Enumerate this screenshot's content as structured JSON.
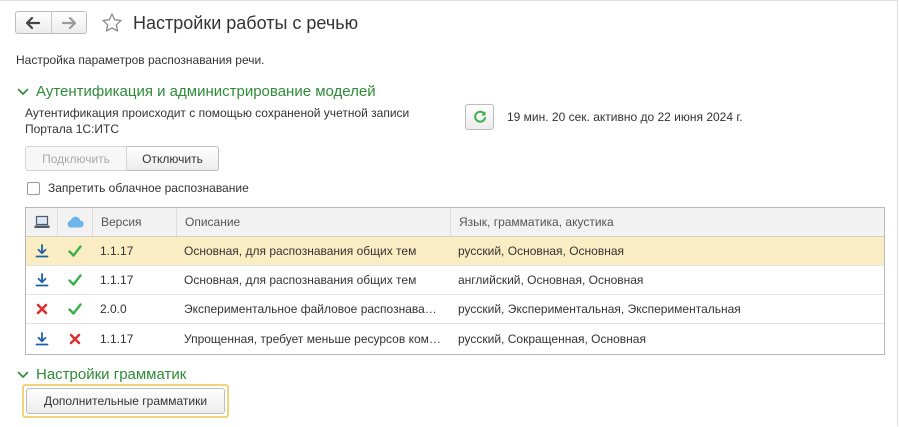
{
  "header": {
    "title": "Настройки работы с речью",
    "back_icon": "arrow-left-icon",
    "forward_icon": "arrow-right-icon",
    "favorite_icon": "star-icon"
  },
  "subtitle": "Настройка параметров распознавания речи.",
  "auth_section": {
    "title": "Аутентификация и администрирование моделей",
    "auth_text": "Аутентификация происходит с помощью сохраненой учетной записи Портала 1С:ИТС",
    "status_text": "19 мин. 20 сек. активно до 22 июня 2024 г.",
    "connect_label": "Подключить",
    "disconnect_label": "Отключить",
    "disable_cloud_label": "Запретить облачное распознавание",
    "disable_cloud_checked": false
  },
  "table": {
    "columns": {
      "local_icon": "computer-icon",
      "cloud_icon": "cloud-icon",
      "version": "Версия",
      "description": "Описание",
      "language": "Язык, грамматика, акустика"
    },
    "rows": [
      {
        "local": "download",
        "cloud": "check",
        "version": "1.1.17",
        "description": "Основная, для распознавания общих тем",
        "language": "русский, Основная, Основная",
        "selected": true
      },
      {
        "local": "download",
        "cloud": "check",
        "version": "1.1.17",
        "description": "Основная, для распознавания общих тем",
        "language": "английский, Основная, Основная",
        "selected": false
      },
      {
        "local": "cross",
        "cloud": "check",
        "version": "2.0.0",
        "description": "Экспериментальное файловое распознавание",
        "language": "русский, Экспериментальная, Экспериментальная",
        "selected": false
      },
      {
        "local": "download",
        "cloud": "cross",
        "version": "1.1.17",
        "description": "Упрощенная, требует меньше ресурсов компьютера",
        "language": "русский, Сокращенная, Основная",
        "selected": false
      }
    ]
  },
  "grammar_section": {
    "title": "Настройки грамматик",
    "extra_grammars_label": "Дополнительные грамматики"
  },
  "colors": {
    "accent_green": "#2e8b3a",
    "selected_row": "#fbedc3",
    "download_blue": "#1f5fa8",
    "check_green": "#3cae4a",
    "cross_red": "#e0302f"
  }
}
